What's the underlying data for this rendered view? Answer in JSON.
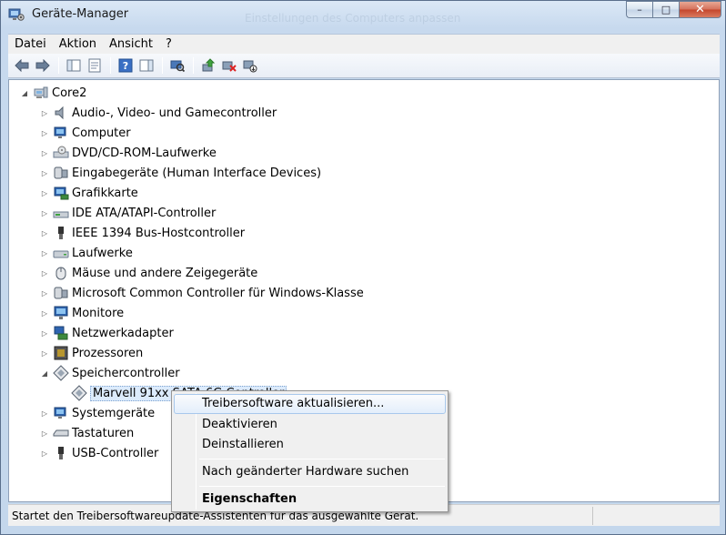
{
  "window": {
    "title": "Geräte-Manager"
  },
  "caption": {
    "minimize": "–",
    "maximize": "□",
    "close": "✕"
  },
  "menu": [
    "Datei",
    "Aktion",
    "Ansicht",
    "?"
  ],
  "toolbar_icons": [
    "back-icon",
    "forward-icon",
    "show-hide-console-tree-icon",
    "properties-icon",
    "help-icon",
    "action-pane-icon",
    "scan-hardware-icon",
    "update-driver-icon",
    "uninstall-icon",
    "disable-icon"
  ],
  "tree": {
    "root": "Core2",
    "items": [
      {
        "label": "Audio-, Video- und Gamecontroller",
        "icon": "speaker-icon"
      },
      {
        "label": "Computer",
        "icon": "computer-icon"
      },
      {
        "label": "DVD/CD-ROM-Laufwerke",
        "icon": "dvd-drive-icon"
      },
      {
        "label": "Eingabegeräte (Human Interface Devices)",
        "icon": "hid-icon"
      },
      {
        "label": "Grafikkarte",
        "icon": "display-adapter-icon"
      },
      {
        "label": "IDE ATA/ATAPI-Controller",
        "icon": "ide-controller-icon"
      },
      {
        "label": "IEEE 1394 Bus-Hostcontroller",
        "icon": "firewire-icon"
      },
      {
        "label": "Laufwerke",
        "icon": "disk-drive-icon"
      },
      {
        "label": "Mäuse und andere Zeigegeräte",
        "icon": "mouse-icon"
      },
      {
        "label": "Microsoft Common Controller für Windows-Klasse",
        "icon": "controller-icon"
      },
      {
        "label": "Monitore",
        "icon": "monitor-icon"
      },
      {
        "label": "Netzwerkadapter",
        "icon": "network-adapter-icon"
      },
      {
        "label": "Prozessoren",
        "icon": "processor-icon"
      },
      {
        "label": "Speichercontroller",
        "icon": "storage-controller-icon"
      }
    ],
    "storage_child": "Marvell 91xx SATA 6G Controller",
    "after_items": [
      {
        "label": "Systemgeräte",
        "icon": "system-devices-icon"
      },
      {
        "label": "Tastaturen",
        "icon": "keyboard-icon"
      },
      {
        "label": "USB-Controller",
        "icon": "usb-icon"
      }
    ]
  },
  "context_menu": {
    "update": "Treibersoftware aktualisieren...",
    "disable": "Deaktivieren",
    "uninstall": "Deinstallieren",
    "scan": "Nach geänderter Hardware suchen",
    "properties": "Eigenschaften"
  },
  "statusbar": {
    "text": "Startet den Treibersoftwareupdate-Assistenten für das ausgewählte Gerät."
  },
  "background_window_text": "Einstellungen des Computers anpassen"
}
